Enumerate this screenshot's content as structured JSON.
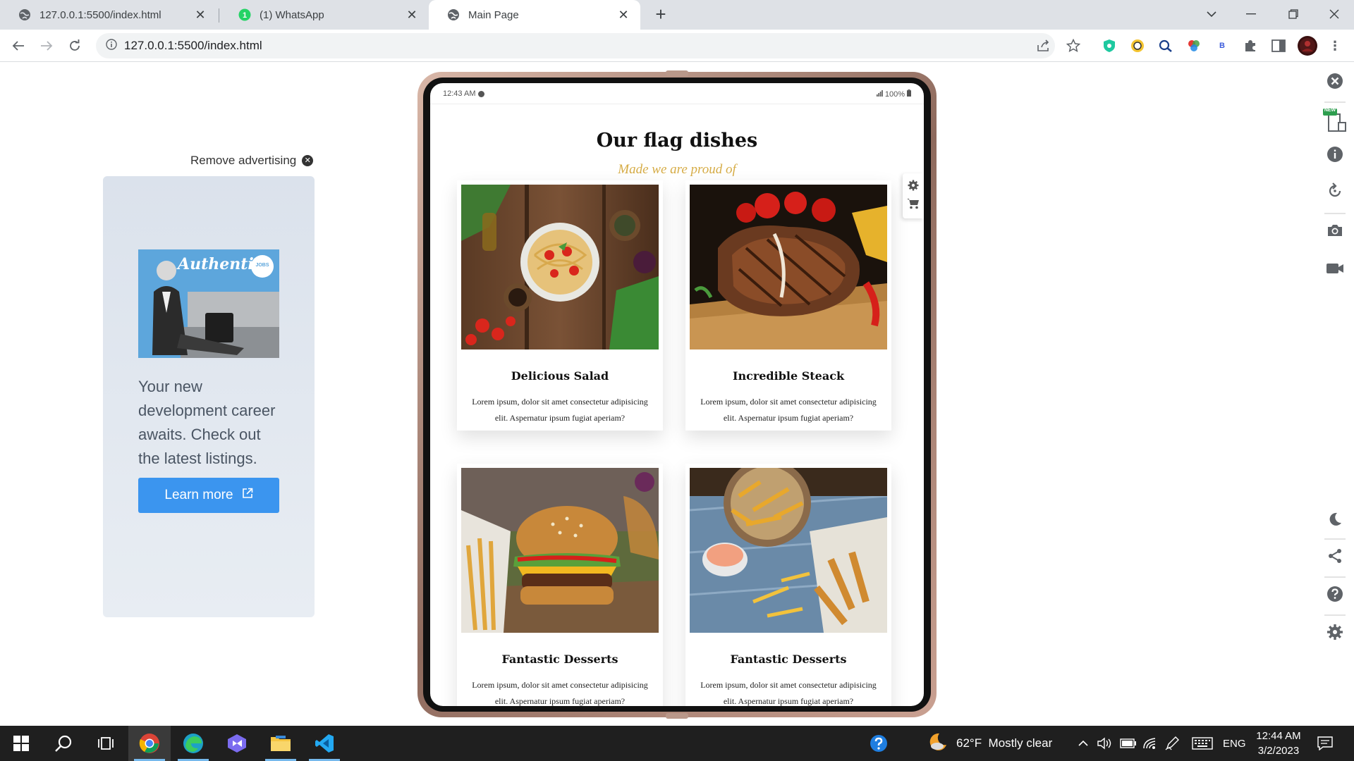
{
  "browser": {
    "tabs": [
      {
        "title": "127.0.0.1:5500/index.html",
        "favicon": "globe-icon",
        "active": false
      },
      {
        "title": "(1) WhatsApp",
        "favicon": "whatsapp-icon",
        "badge": "1",
        "active": false
      },
      {
        "title": "Main Page",
        "favicon": "globe-icon",
        "active": true
      }
    ],
    "new_tab": "+",
    "window_controls": {
      "minimize": "—",
      "restore": "❐",
      "close": "✕",
      "tab_search": "⌄"
    },
    "url": "127.0.0.1:5500/index.html",
    "nav": {
      "back": "←",
      "forward": "→",
      "reload": "↻",
      "site_info": "ⓘ"
    }
  },
  "ad": {
    "remove_label": "Remove advertising",
    "image_script": "Authentic",
    "image_badge": "JOBS",
    "text": "Your new development career awaits. Check out the latest listings.",
    "button_label": "Learn more"
  },
  "device": {
    "status_time": "12:43 AM",
    "status_battery": "100%"
  },
  "section": {
    "title": "Our flag dishes",
    "subtitle": "Made we are proud of"
  },
  "dishes": [
    {
      "name": "Delicious Salad",
      "desc": "Lorem ipsum, dolor sit amet consectetur adipisicing elit. Aspernatur ipsum fugiat aperiam?",
      "image": "pasta-photo"
    },
    {
      "name": "Incredible Steack",
      "desc": "Lorem ipsum, dolor sit amet consectetur adipisicing elit. Aspernatur ipsum fugiat aperiam?",
      "image": "steak-photo"
    },
    {
      "name": "Fantastic Desserts",
      "desc": "Lorem ipsum, dolor sit amet consectetur adipisicing elit. Aspernatur ipsum fugiat aperiam?",
      "image": "burger-photo"
    },
    {
      "name": "Fantastic Desserts",
      "desc": "Lorem ipsum, dolor sit amet consectetur adipisicing elit. Aspernatur ipsum fugiat aperiam?",
      "image": "fries-photo"
    }
  ],
  "sidebar_badge": "NEW",
  "taskbar": {
    "weather": "62°F  Mostly clear",
    "language": "ENG",
    "time": "12:44 AM",
    "date": "3/2/2023"
  },
  "colors": {
    "accent_gold": "#d6ac46",
    "ad_button": "#3b95ef",
    "taskbar": "#1f1f1f"
  }
}
